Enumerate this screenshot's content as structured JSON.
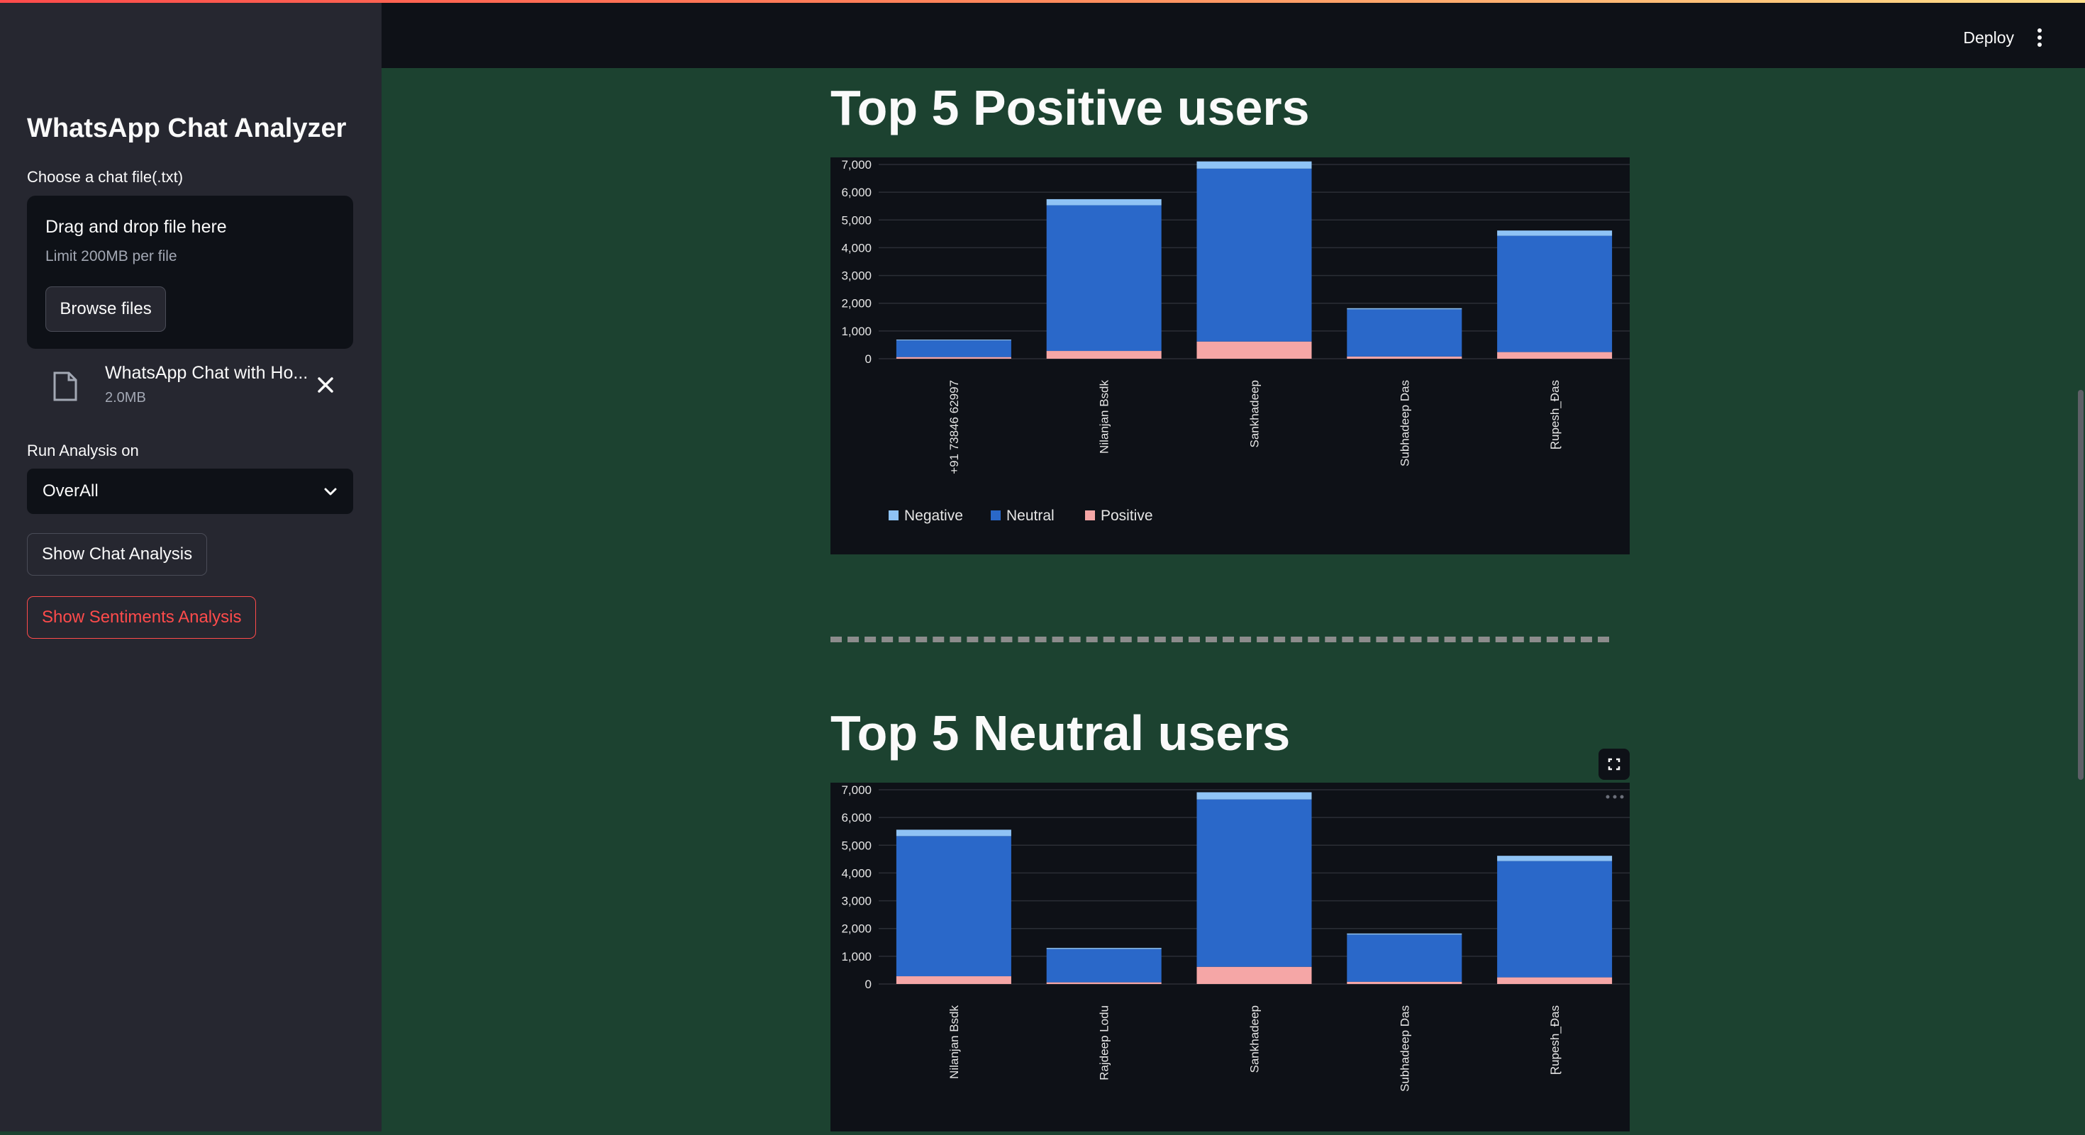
{
  "header": {
    "deploy_label": "Deploy",
    "menu_icon": "kebab-menu-icon"
  },
  "sidebar": {
    "title": "WhatsApp Chat Analyzer",
    "file_label": "Choose a chat file(.txt)",
    "dropzone": {
      "title": "Drag and drop file here",
      "limit": "Limit 200MB per file",
      "browse_label": "Browse files"
    },
    "uploaded_file": {
      "name": "WhatsApp Chat with Ho...",
      "size": "2.0MB",
      "icon": "file-icon"
    },
    "analysis_label": "Run Analysis on",
    "analysis_value": "OverAll",
    "show_chat_label": "Show Chat Analysis",
    "show_sentiment_label": "Show Sentiments Analysis"
  },
  "main": {
    "positive_title": "Top 5 Positive users",
    "neutral_title": "Top 5 Neutral users"
  },
  "colors": {
    "negative": "#8fc3f5",
    "neutral": "#2a68c9",
    "positive": "#f5a6a6"
  },
  "chart_data": [
    {
      "type": "bar",
      "stacked": true,
      "categories": [
        "+91 73846 62997",
        "Nilanjan Bsdk",
        "Sankhadeep",
        "Subhadeep Das",
        "Ɽupesh_Ɖas"
      ],
      "series": [
        {
          "name": "Positive",
          "values": [
            60,
            280,
            620,
            80,
            240
          ]
        },
        {
          "name": "Neutral",
          "values": [
            600,
            5250,
            6230,
            1700,
            4190
          ]
        },
        {
          "name": "Negative",
          "values": [
            30,
            220,
            260,
            40,
            190
          ]
        }
      ],
      "legend_order": [
        "Negative",
        "Neutral",
        "Positive"
      ],
      "yticks": [
        "0",
        "1,000",
        "2,000",
        "3,000",
        "4,000",
        "5,000",
        "6,000",
        "7,000"
      ],
      "ylim": [
        0,
        7000
      ],
      "legend": "bottom-left",
      "grid": true
    },
    {
      "type": "bar",
      "stacked": true,
      "categories": [
        "Nilanjan Bsdk",
        "Rajdeep Lodu",
        "Sankhadeep",
        "Subhadeep Das",
        "Ɽupesh_Ɖas"
      ],
      "series": [
        {
          "name": "Positive",
          "values": [
            280,
            60,
            620,
            80,
            240
          ]
        },
        {
          "name": "Neutral",
          "values": [
            5050,
            1200,
            6030,
            1700,
            4190
          ]
        },
        {
          "name": "Negative",
          "values": [
            230,
            40,
            260,
            40,
            190
          ]
        }
      ],
      "yticks": [
        "0",
        "1,000",
        "2,000",
        "3,000",
        "4,000",
        "5,000",
        "6,000",
        "7,000"
      ],
      "ylim": [
        0,
        7000
      ],
      "grid": true
    }
  ]
}
